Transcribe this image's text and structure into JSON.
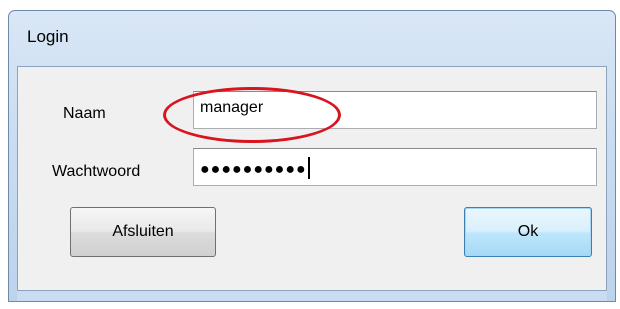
{
  "window": {
    "title": "Login"
  },
  "form": {
    "naam_label": "Naam",
    "naam_value": "manager",
    "wachtwoord_label": "Wachtwoord",
    "wachtwoord_masked": "●●●●●●●●●●"
  },
  "buttons": {
    "afsluiten_label": "Afsluiten",
    "ok_label": "Ok"
  },
  "colors": {
    "highlight_ellipse": "#d9141e",
    "default_button_border": "#3c7fb1"
  }
}
